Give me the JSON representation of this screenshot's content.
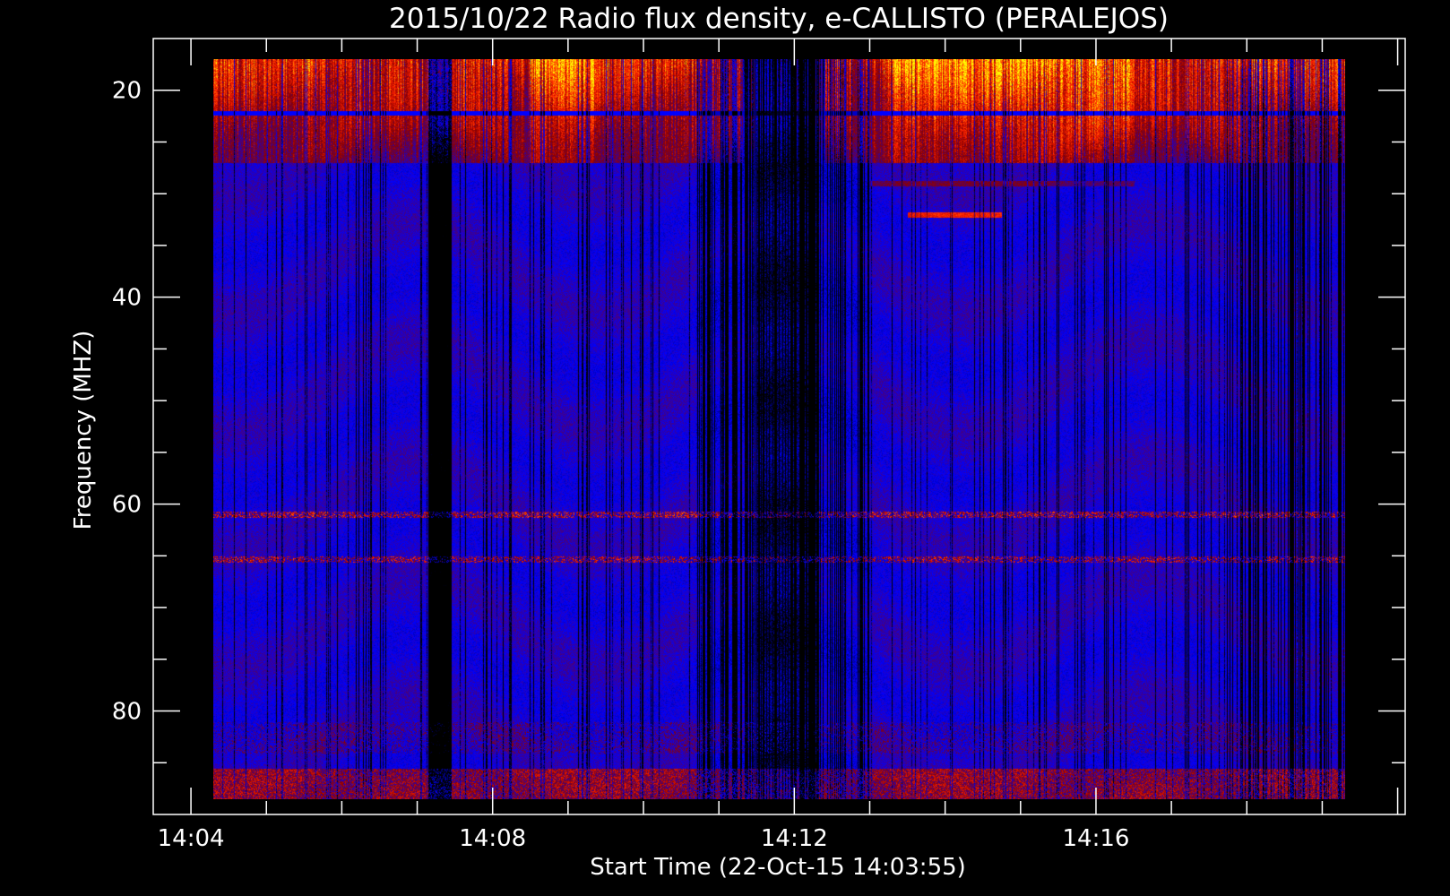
{
  "chart_data": {
    "type": "heatmap",
    "title": "2015/10/22  Radio flux density, e-CALLISTO (PERALEJOS)",
    "xlabel": "Start Time (22-Oct-15 14:03:55)",
    "ylabel": "Frequency (MHZ)",
    "x_ticks": [
      "14:04",
      "14:08",
      "14:12",
      "14:16"
    ],
    "y_ticks": [
      "20",
      "40",
      "60",
      "80"
    ],
    "xlim": [
      "14:04",
      "14:19"
    ],
    "ylim": [
      15,
      90
    ],
    "data_extent": {
      "time_start": "14:04:18",
      "time_end": "14:19:18",
      "freq_min": 17,
      "freq_max": 88.5
    },
    "colorscale": [
      "#000000",
      "#0000ff",
      "#8b0000",
      "#ff2000",
      "#ff8000",
      "#ffff00"
    ],
    "features": [
      {
        "type": "band",
        "freq_range": [
          17,
          27
        ],
        "description_level": "high"
      },
      {
        "type": "line",
        "freq": 61.0,
        "level": "medium"
      },
      {
        "type": "line",
        "freq": 65.3,
        "level": "medium"
      },
      {
        "type": "line",
        "freq": 32.0,
        "time_range": [
          "14:13:30",
          "14:14:45"
        ],
        "level": "medium"
      },
      {
        "type": "band",
        "freq_range": [
          85.5,
          88.5
        ],
        "level": "medium"
      }
    ]
  }
}
